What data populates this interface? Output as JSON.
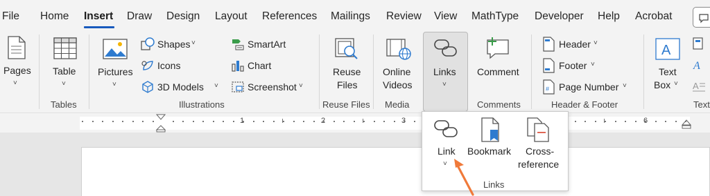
{
  "menu": {
    "tabs": [
      "File",
      "Home",
      "Insert",
      "Draw",
      "Design",
      "Layout",
      "References",
      "Mailings",
      "Review",
      "View",
      "MathType",
      "Developer",
      "Help",
      "Acrobat"
    ]
  },
  "ribbon": {
    "pages": "Pages",
    "tables": {
      "table": "Table",
      "group": "Tables"
    },
    "illustrations": {
      "pictures": "Pictures",
      "shapes": "Shapes",
      "icons": "Icons",
      "models3d": "3D Models",
      "smartart": "SmartArt",
      "chart": "Chart",
      "screenshot": "Screenshot",
      "group": "Illustrations"
    },
    "reuse": {
      "line1": "Reuse",
      "line2": "Files",
      "group": "Reuse Files"
    },
    "media": {
      "line1": "Online",
      "line2": "Videos",
      "group": "Media"
    },
    "links": {
      "label": "Links"
    },
    "comments": {
      "comment": "Comment",
      "group": "Comments"
    },
    "header_footer": {
      "header": "Header",
      "footer": "Footer",
      "page_number": "Page Number",
      "group": "Header & Footer"
    },
    "text": {
      "textbox_line1": "Text",
      "textbox_line2": "Box",
      "group": "Text"
    }
  },
  "ruler": {
    "numbers": [
      "1",
      "2",
      "3",
      "6"
    ]
  },
  "dropdown": {
    "link": "Link",
    "bookmark": "Bookmark",
    "crossref_line1": "Cross-",
    "crossref_line2": "reference",
    "group": "Links"
  },
  "colors": {
    "accent": "#185abd",
    "arrow": "#f07a3a"
  }
}
